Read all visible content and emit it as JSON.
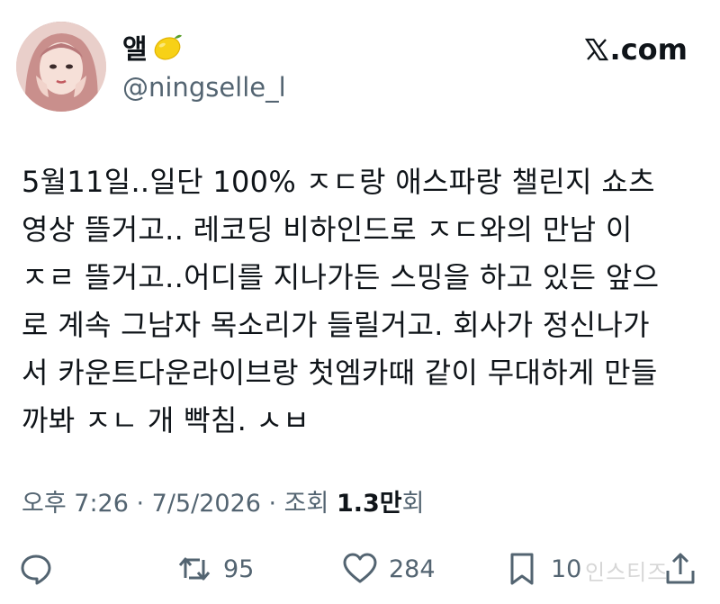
{
  "author": {
    "display_name": "앨",
    "name_emoji_icon": "lemon-icon",
    "handle": "@ningselle_l",
    "avatar_icon": "avatar"
  },
  "source": {
    "logo_icon": "x-logo-icon",
    "label": ".com"
  },
  "tweet": {
    "lines": [
      "5월11일..일단 100% ㅈㄷ랑 애스파랑 챌린지 쇼츠",
      "영상 뜰거고.. 레코딩 비하인드로 ㅈㄷ와의 만남 이",
      "ㅈㄹ 뜰거고..어디를 지나가든 스밍을 하고 있든 앞으",
      "로 계속 그남자 목소리가 들릴거고. 회사가 정신나가",
      "서 카운트다운라이브랑 첫엠카때 같이 무대하게 만들",
      "까봐 ㅈㄴ 개 빡침. ㅅㅂ"
    ]
  },
  "meta": {
    "time": "오후 7:26",
    "sep1": " · ",
    "date": "7/5/2026",
    "sep2": " · ",
    "views_label": "조회 ",
    "views_count": "1.3만",
    "views_suffix": "회"
  },
  "actions": {
    "replies": "",
    "retweets": "95",
    "likes": "284",
    "bookmarks": "10"
  },
  "watermark": "인스티즈",
  "colors": {
    "text": "#0f1419",
    "secondary": "#536471",
    "background": "#ffffff"
  }
}
